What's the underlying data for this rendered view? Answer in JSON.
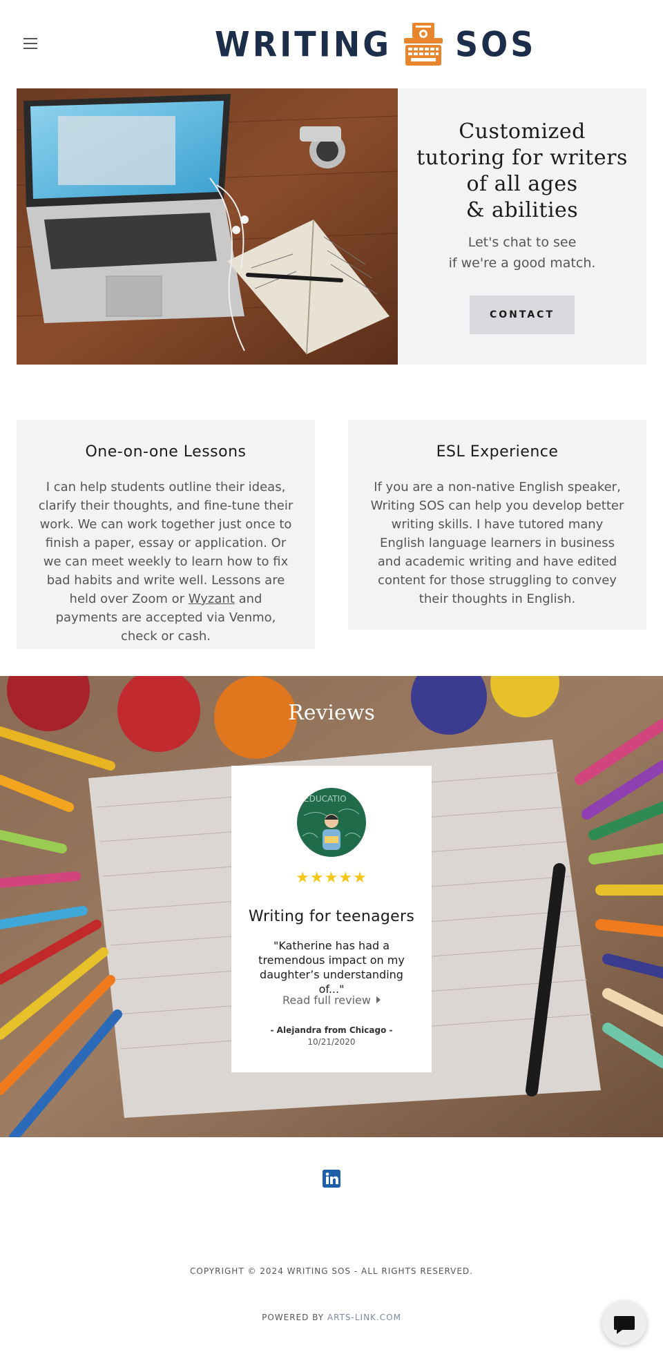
{
  "header": {
    "menu_icon": "hamburger-icon",
    "logo_left": "WRITING",
    "logo_right": "SOS",
    "logo_icon": "typewriter-icon",
    "brand_colors": {
      "navy": "#1c2e4a",
      "orange": "#e9852c"
    }
  },
  "hero": {
    "image": "laptop-notebook-photo",
    "title": "Customized\ntutoring for writers\nof all ages\n& abilities",
    "subtitle": "Let's chat to see\nif we're a good match.",
    "button_label": "CONTACT"
  },
  "cards": [
    {
      "title": "One-on-one Lessons",
      "body_before_link": "I can help students outline their ideas, clarify their thoughts, and fine-tune their work. We can work together just once to finish a paper, essay or application. Or we can meet weekly to learn how to fix bad habits and write well. Lessons are held over Zoom or ",
      "link_text": "Wyzant",
      "body_after_link": " and payments are accepted via Venmo, check or cash."
    },
    {
      "title": "ESL Experience",
      "body": "If you are a non-native English speaker, Writing SOS can help you develop better writing skills. I have tutored many English language learners in business and academic writing and have edited content for those struggling to convey their thoughts in English."
    }
  ],
  "reviews": {
    "title": "Reviews",
    "background": "colored-pencils-notebook-photo",
    "item": {
      "avatar": "education-chalkboard-avatar",
      "rating": 5,
      "stars": "★★★★★",
      "heading": "Writing for teenagers",
      "quote": "\"Katherine has had a tremendous impact on my daughter’s understanding of...\"",
      "read_more": "Read full review",
      "author": "- Alejandra from Chicago -",
      "date": "10/21/2020"
    }
  },
  "footer": {
    "social_icon": "linkedin-icon",
    "copyright": "COPYRIGHT © 2024 WRITING SOS - ALL RIGHTS RESERVED.",
    "powered_prefix": "POWERED BY ",
    "powered_link": "ARTS-LINK.COM",
    "chat_icon": "chat-bubble-icon"
  }
}
